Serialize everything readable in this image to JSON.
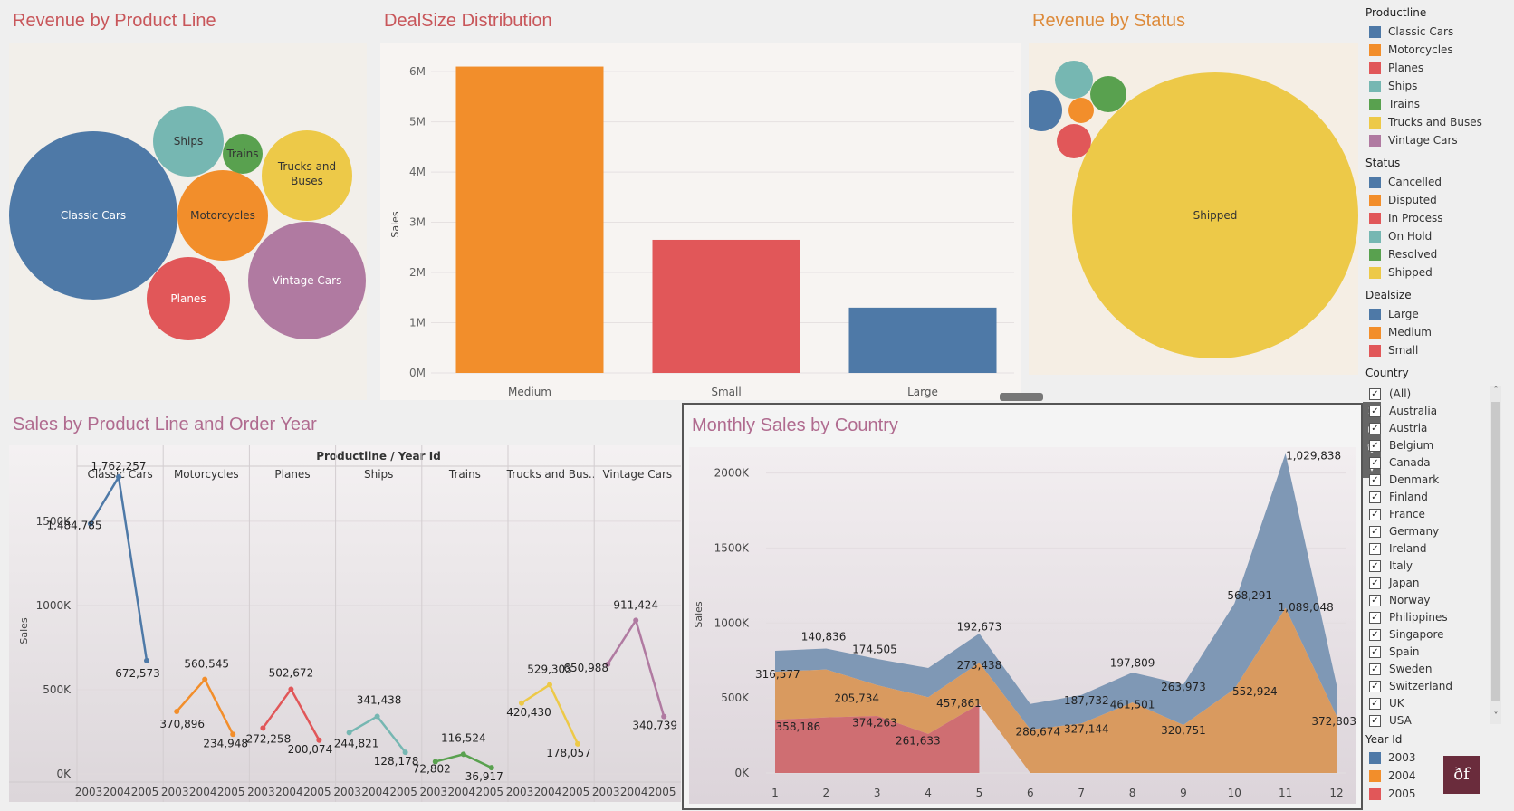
{
  "titles": {
    "product_line": "Revenue by Product Line",
    "dealsize": "DealSize Distribution",
    "status": "Revenue by Status",
    "product_year": "Sales by Product Line and Order Year",
    "monthly": "Monthly Sales by Country"
  },
  "bubbles_product": [
    {
      "label": "Classic Cars",
      "color": "#4e79a7"
    },
    {
      "label": "Ships",
      "color": "#76b7b2"
    },
    {
      "label": "Trains",
      "color": "#59a14f"
    },
    {
      "label": "Trucks and Buses",
      "color": "#edc948"
    },
    {
      "label": "Motorcycles",
      "color": "#f28e2b"
    },
    {
      "label": "Vintage Cars",
      "color": "#b07aa1"
    },
    {
      "label": "Planes",
      "color": "#e15759"
    }
  ],
  "bubbles_status": [
    {
      "label": "Shipped",
      "color": "#edc948"
    },
    {
      "label": "",
      "color": "#76b7b2"
    },
    {
      "label": "",
      "color": "#59a14f"
    },
    {
      "label": "",
      "color": "#4e79a7"
    },
    {
      "label": "",
      "color": "#f28e2b"
    },
    {
      "label": "",
      "color": "#e15759"
    }
  ],
  "chart_data": [
    {
      "type": "bar",
      "title": "DealSize Distribution",
      "ylabel": "Sales",
      "categories": [
        "Medium",
        "Small",
        "Large"
      ],
      "values": [
        6100000,
        2650000,
        1300000
      ],
      "colors": [
        "#f28e2b",
        "#e15759",
        "#4e79a7"
      ],
      "ylim": [
        0,
        6200000
      ],
      "yticks": [
        "0M",
        "1M",
        "2M",
        "3M",
        "4M",
        "5M",
        "6M"
      ]
    },
    {
      "type": "line",
      "title": "Sales by Product Line and Order Year",
      "header": "Productline / Year Id",
      "ylabel": "Sales",
      "ylim": [
        0,
        1800000
      ],
      "yticks": [
        "0K",
        "500K",
        "1000K",
        "1500K"
      ],
      "years": [
        "2003",
        "2004",
        "2005"
      ],
      "series": [
        {
          "name": "Classic Cars",
          "color": "#4e79a7",
          "values": [
            1484785,
            1762257,
            672573
          ],
          "labels": [
            "1,484,785",
            "1,762,257",
            "672,573"
          ]
        },
        {
          "name": "Motorcycles",
          "color": "#f28e2b",
          "values": [
            370896,
            560545,
            234948
          ],
          "labels": [
            "370,896",
            "560,545",
            "234,948"
          ]
        },
        {
          "name": "Planes",
          "color": "#e15759",
          "values": [
            272258,
            502672,
            200074
          ],
          "labels": [
            "272,258",
            "502,672",
            "200,074"
          ]
        },
        {
          "name": "Ships",
          "color": "#76b7b2",
          "values": [
            244821,
            341438,
            128178
          ],
          "labels": [
            "244,821",
            "341,438",
            "128,178"
          ]
        },
        {
          "name": "Trains",
          "color": "#59a14f",
          "values": [
            72802,
            116524,
            36917
          ],
          "labels": [
            "72,802",
            "116,524",
            "36,917"
          ]
        },
        {
          "name": "Trucks and Bus..",
          "color": "#edc948",
          "values": [
            420430,
            529303,
            178057
          ],
          "labels": [
            "420,430",
            "529,303",
            "178,057"
          ]
        },
        {
          "name": "Vintage Cars",
          "color": "#b07aa1",
          "values": [
            650988,
            911424,
            340739
          ],
          "labels": [
            "650,988",
            "911,424",
            "340,739"
          ]
        }
      ]
    },
    {
      "type": "area",
      "title": "Monthly Sales by Country",
      "ylabel": "Sales",
      "x": [
        1,
        2,
        3,
        4,
        5,
        6,
        7,
        8,
        9,
        10,
        11,
        12
      ],
      "ylim": [
        0,
        2100000
      ],
      "yticks": [
        "0K",
        "500K",
        "1000K",
        "1500K",
        "2000K"
      ],
      "series": [
        {
          "name": "2005",
          "color": "#e15759",
          "values": [
            358186,
            374263,
            261633,
            457861,
            286674
          ]
        },
        {
          "name": "2004",
          "color": "#f28e2b",
          "values": [
            316577,
            205734,
            273438,
            327144,
            461501,
            320751,
            552924,
            1089048,
            372803
          ]
        },
        {
          "name": "2003",
          "color": "#4e79a7",
          "values": [
            140836,
            174505,
            192673,
            187732,
            197809,
            263973,
            568291,
            1029838
          ]
        }
      ],
      "annotations": [
        "140,836",
        "316,577",
        "358,186",
        "174,505",
        "205,734",
        "374,263",
        "261,633",
        "192,673",
        "273,438",
        "457,861",
        "286,674",
        "187,732",
        "327,144",
        "197,809",
        "461,501",
        "263,973",
        "320,751",
        "568,291",
        "552,924",
        "1,029,838",
        "1,089,048",
        "372,803"
      ]
    }
  ],
  "legend": {
    "productline_title": "Productline",
    "productline": [
      {
        "label": "Classic Cars",
        "color": "#4e79a7"
      },
      {
        "label": "Motorcycles",
        "color": "#f28e2b"
      },
      {
        "label": "Planes",
        "color": "#e15759"
      },
      {
        "label": "Ships",
        "color": "#76b7b2"
      },
      {
        "label": "Trains",
        "color": "#59a14f"
      },
      {
        "label": "Trucks and Buses",
        "color": "#edc948"
      },
      {
        "label": "Vintage Cars",
        "color": "#b07aa1"
      }
    ],
    "status_title": "Status",
    "status": [
      {
        "label": "Cancelled",
        "color": "#4e79a7"
      },
      {
        "label": "Disputed",
        "color": "#f28e2b"
      },
      {
        "label": "In Process",
        "color": "#e15759"
      },
      {
        "label": "On Hold",
        "color": "#76b7b2"
      },
      {
        "label": "Resolved",
        "color": "#59a14f"
      },
      {
        "label": "Shipped",
        "color": "#edc948"
      }
    ],
    "dealsize_title": "Dealsize",
    "dealsize": [
      {
        "label": "Large",
        "color": "#4e79a7"
      },
      {
        "label": "Medium",
        "color": "#f28e2b"
      },
      {
        "label": "Small",
        "color": "#e15759"
      }
    ],
    "country_title": "Country",
    "countries": [
      "(All)",
      "Australia",
      "Austria",
      "Belgium",
      "Canada",
      "Denmark",
      "Finland",
      "France",
      "Germany",
      "Ireland",
      "Italy",
      "Japan",
      "Norway",
      "Philippines",
      "Singapore",
      "Spain",
      "Sweden",
      "Switzerland",
      "UK",
      "USA"
    ],
    "year_title": "Year Id",
    "years": [
      {
        "label": "2003",
        "color": "#4e79a7"
      },
      {
        "label": "2004",
        "color": "#f28e2b"
      },
      {
        "label": "2005",
        "color": "#e15759"
      }
    ]
  },
  "toolbar_icons": [
    "close-icon",
    "popout-icon",
    "filter-icon",
    "dropdown-icon"
  ],
  "logo_text": "ðf"
}
